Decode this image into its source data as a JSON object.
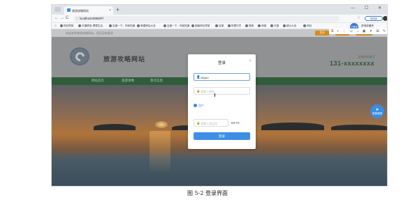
{
  "browser": {
    "tab_title": "旅游攻略网站",
    "tab_close": "×",
    "new_tab": "+",
    "window_controls": "— ☐ ✕",
    "url": "localhost:8080/#/",
    "nav": {
      "back": "←",
      "forward": "→",
      "reload": "C",
      "home": "⌂"
    },
    "addr_icons": "☆ ⊙ ✩",
    "sync_label": "未同步",
    "bookmarks": [
      "网址导航",
      "天猫精选-理想生活...",
      "百度一下，你就知道",
      "新建网址大全",
      "百度一下，你就知道",
      "超级网址导航",
      "百度",
      "阿里巴巴",
      "搜索",
      "淘宝",
      "天猫",
      "超火大全",
      "网址",
      "其他收藏夹"
    ]
  },
  "site": {
    "welcome": "欢迎来到旅游攻略网站，您还没有登录",
    "top_buttons": [
      "登录",
      "注册",
      "游客登录"
    ],
    "title": "旅游攻略网站",
    "hotline_label": "咨询热线电话",
    "hotline": "131-xxxxxxxx",
    "nav": [
      "网站首页",
      "旅游攻略",
      "景点信息"
    ],
    "float_avatar": "已登录",
    "feedback": "智能客服"
  },
  "modal": {
    "title": "登录",
    "close": "×",
    "username_icon": "👤",
    "username_value": "zhiyao",
    "password_icon": "🔒",
    "password_placeholder": "请输入密码",
    "role_label": "用户",
    "captcha_icon": "🔒",
    "captcha_placeholder": "请输入验证码",
    "captcha_code": "8676",
    "login_button": "登录"
  },
  "caption": "图 5-2  登录界面",
  "colors": {
    "accent": "#3d8fe6",
    "orange": "#d68b1c",
    "nav_green": "#2f5d3a"
  }
}
